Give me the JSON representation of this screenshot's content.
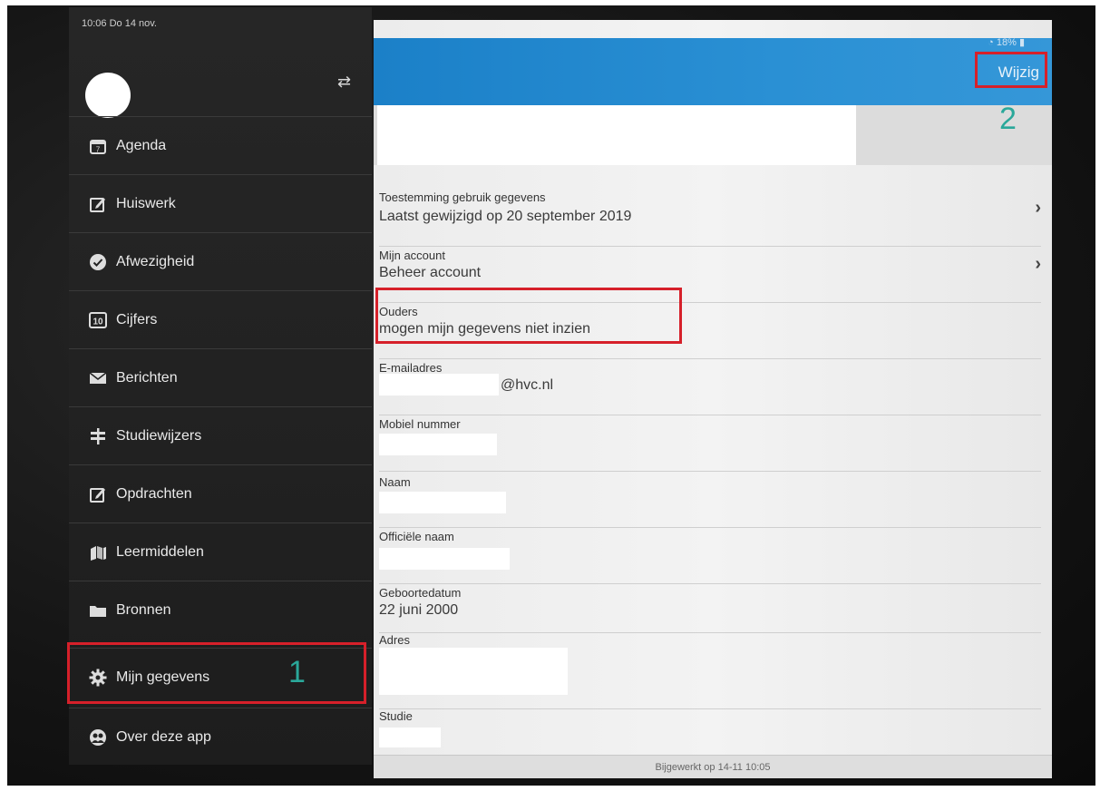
{
  "status_bar": {
    "time_date": "10:06  Do 14 nov.",
    "right": "18%"
  },
  "sidebar": {
    "switch_icon": "swap-arrows-icon",
    "items": [
      {
        "label": "Agenda",
        "icon": "calendar-icon"
      },
      {
        "label": "Huiswerk",
        "icon": "edit-icon"
      },
      {
        "label": "Afwezigheid",
        "icon": "check-circle-icon"
      },
      {
        "label": "Cijfers",
        "icon": "grade-10-icon"
      },
      {
        "label": "Berichten",
        "icon": "envelope-icon"
      },
      {
        "label": "Studiewijzers",
        "icon": "signpost-icon"
      },
      {
        "label": "Opdrachten",
        "icon": "edit-icon"
      },
      {
        "label": "Leermiddelen",
        "icon": "books-icon"
      },
      {
        "label": "Bronnen",
        "icon": "folder-icon"
      },
      {
        "label": "Mijn gegevens",
        "icon": "gear-icon"
      },
      {
        "label": "Over deze app",
        "icon": "info-people-icon"
      }
    ]
  },
  "header": {
    "edit_button": "Wijzig"
  },
  "annotations": {
    "marker_1": "1",
    "marker_2": "2"
  },
  "details": {
    "consent": {
      "label": "Toestemming gebruik gegevens",
      "value": "Laatst gewijzigd op 20 september 2019"
    },
    "account": {
      "label": "Mijn account",
      "value": "Beheer account"
    },
    "parents": {
      "label": "Ouders",
      "value": "mogen mijn gegevens niet inzien"
    },
    "email": {
      "label": "E-mailadres",
      "value": "@hvc.nl"
    },
    "mobile": {
      "label": "Mobiel nummer"
    },
    "name": {
      "label": "Naam"
    },
    "official_name": {
      "label": "Officiële naam"
    },
    "birthdate": {
      "label": "Geboortedatum",
      "value": "22 juni 2000"
    },
    "address": {
      "label": "Adres"
    },
    "study": {
      "label": "Studie"
    }
  },
  "footer": {
    "updated": "Bijgewerkt op 14-11 10:05"
  },
  "colors": {
    "accent_blue": "#2a90d4",
    "highlight_red": "#d6202a",
    "marker_teal": "#2aa89a"
  }
}
